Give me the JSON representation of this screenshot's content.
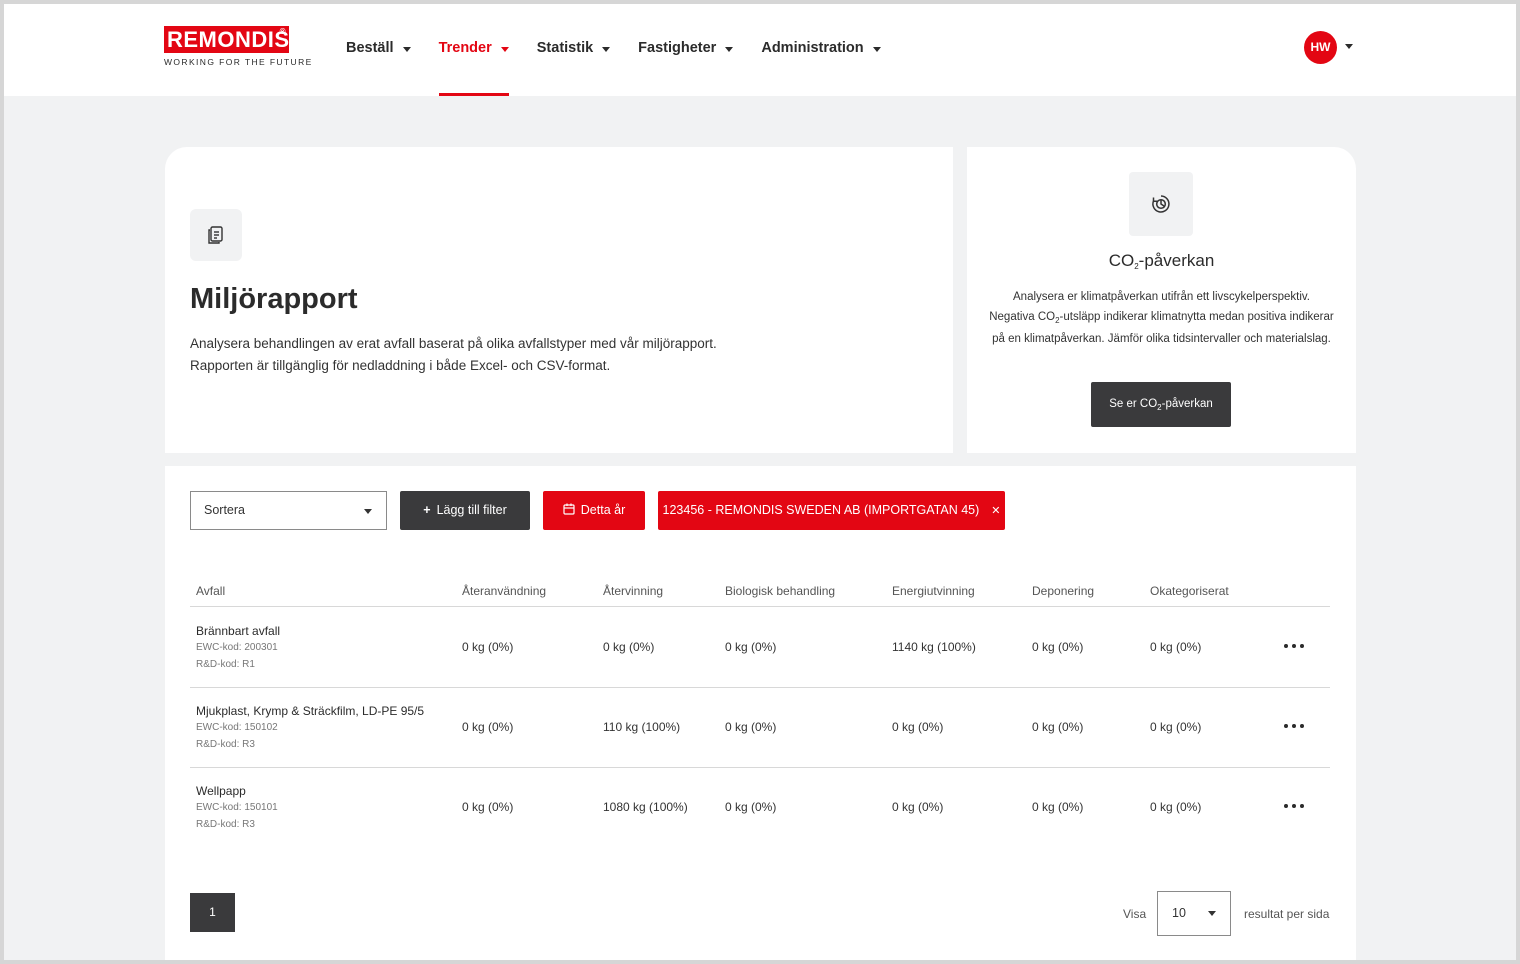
{
  "brand": {
    "name": "REMONDIS",
    "registered": "®",
    "tagline": "WORKING FOR THE FUTURE"
  },
  "nav": {
    "items": [
      {
        "label": "Beställ",
        "active": false
      },
      {
        "label": "Trender",
        "active": true
      },
      {
        "label": "Statistik",
        "active": false
      },
      {
        "label": "Fastigheter",
        "active": false
      },
      {
        "label": "Administration",
        "active": false
      }
    ]
  },
  "user": {
    "initials": "HW"
  },
  "report": {
    "icon": "document-icon",
    "title": "Miljörapport",
    "description_line1": "Analysera behandlingen av erat avfall baserat på olika avfallstyper med vår miljörapport.",
    "description_line2": "Rapporten är tillgänglig för nedladdning i både Excel- och CSV-format."
  },
  "co2": {
    "icon": "chart-cycle-icon",
    "title_prefix": "CO",
    "title_sub": "2",
    "title_suffix": "-påverkan",
    "desc_part1": "Analysera er klimatpåverkan utifrån ett livscykelperspektiv. Negativa CO",
    "desc_sub": "2",
    "desc_part2": "-utsläpp indikerar klimatnytta medan positiva indikerar på en klimatpåverkan. Jämför olika tidsintervaller och materialslag.",
    "button_prefix": "Se er CO",
    "button_sub": "2",
    "button_suffix": "-påverkan"
  },
  "filters": {
    "sort_placeholder": "Sortera",
    "add_filter": "Lägg till filter",
    "period": "Detta år",
    "company": "123456 - REMONDIS SWEDEN AB (IMPORTGATAN 45)"
  },
  "table": {
    "columns": [
      "Avfall",
      "Återanvändning",
      "Återvinning",
      "Biologisk behandling",
      "Energiutvinning",
      "Deponering",
      "Okategoriserat"
    ],
    "rows": [
      {
        "name": "Brännbart avfall",
        "ewc": "EWC-kod: 200301",
        "rd": "R&D-kod: R1",
        "values": [
          "0 kg (0%)",
          "0 kg (0%)",
          "0 kg (0%)",
          "1140 kg (100%)",
          "0 kg (0%)",
          "0 kg (0%)"
        ]
      },
      {
        "name": "Mjukplast, Krymp & Sträckfilm, LD-PE 95/5",
        "ewc": "EWC-kod: 150102",
        "rd": "R&D-kod: R3",
        "values": [
          "0 kg (0%)",
          "110 kg (100%)",
          "0 kg (0%)",
          "0 kg (0%)",
          "0 kg (0%)",
          "0 kg (0%)"
        ]
      },
      {
        "name": "Wellpapp",
        "ewc": "EWC-kod: 150101",
        "rd": "R&D-kod: R3",
        "values": [
          "0 kg (0%)",
          "1080 kg (100%)",
          "0 kg (0%)",
          "0 kg (0%)",
          "0 kg (0%)",
          "0 kg (0%)"
        ]
      }
    ]
  },
  "pagination": {
    "current_page": "1",
    "show_label": "Visa",
    "per_page": "10",
    "per_page_suffix": "resultat per sida"
  },
  "colors": {
    "brand_red": "#e30613",
    "dark_button": "#3a3a3c",
    "background": "#f1f2f3"
  }
}
